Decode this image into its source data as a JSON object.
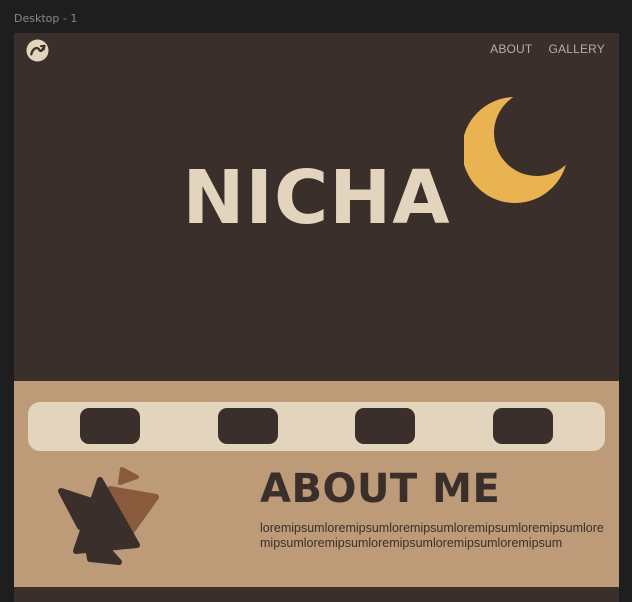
{
  "canvas": {
    "frame_label": "Desktop - 1"
  },
  "header": {
    "logo_icon": "stylized-wave-logo-icon",
    "nav": [
      {
        "label": "ABOUT"
      },
      {
        "label": "GALLERY"
      }
    ]
  },
  "hero": {
    "title": "NICHA",
    "moon_icon": "crescent-moon-icon"
  },
  "about": {
    "gallery_slots": 4,
    "shapes_icon": "overlapping-triangles-icon",
    "title": "ABOUT ME",
    "body": "loremipsumloremipsumloremipsumloremipsumloremipsumloremipsumloremipsumloremipsumloremipsumloremipsum"
  },
  "colors": {
    "background_dark": "#3a2f2a",
    "canvas": "#1e1e1e",
    "cream": "#e2d4bd",
    "tan": "#bd9b78",
    "moon": "#e8b350",
    "accent_brown": "#8a5a3c"
  }
}
